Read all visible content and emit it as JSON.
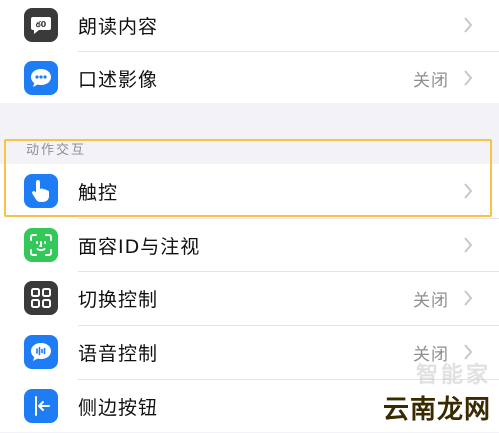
{
  "colors": {
    "page_background": "#f2f2f7",
    "highlight_border": "#f5c24a",
    "icon_gray": "#3a3a3c",
    "icon_blue": "#1e7cf5",
    "icon_green": "#34c759",
    "chevron": "#c7c7cc"
  },
  "group_top": {
    "rows": [
      {
        "label": "朗读内容",
        "value": "",
        "icon": "speech-bubble-icon"
      },
      {
        "label": "口述影像",
        "value": "关闭",
        "icon": "chat-bubble-icon"
      }
    ]
  },
  "section": {
    "header": "动作交互",
    "rows": [
      {
        "label": "触控",
        "value": "",
        "icon": "hand-touch-icon"
      },
      {
        "label": "面容ID与注视",
        "value": "",
        "icon": "face-id-icon"
      },
      {
        "label": "切换控制",
        "value": "关闭",
        "icon": "grid-icon"
      },
      {
        "label": "语音控制",
        "value": "关闭",
        "icon": "voice-control-icon"
      },
      {
        "label": "侧边按钮",
        "value": "",
        "icon": "side-button-icon"
      }
    ]
  },
  "watermark": {
    "line1": "智能家",
    "line2": "云南龙网"
  }
}
